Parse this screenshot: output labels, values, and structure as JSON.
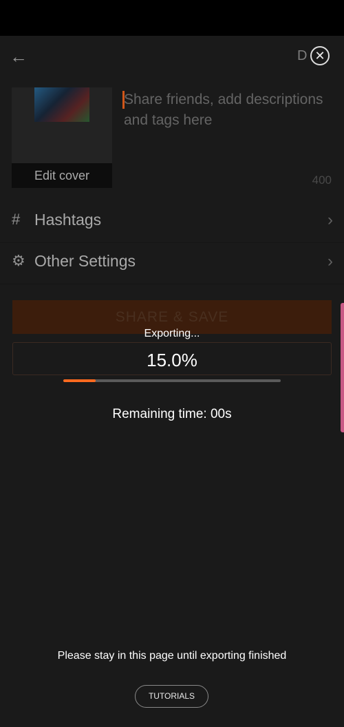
{
  "header": {
    "back_icon": "arrow-left-icon",
    "done_label": "D"
  },
  "cover": {
    "edit_label": "Edit cover"
  },
  "caption": {
    "placeholder": "Share friends, add descriptions and tags here",
    "char_limit": "400"
  },
  "rows": [
    {
      "icon": "hash-icon",
      "label": "Hashtags"
    },
    {
      "icon": "gear-icon",
      "label": "Other Settings"
    }
  ],
  "share_button": "SHARE & SAVE",
  "export": {
    "title": "Exporting...",
    "percent_text": "15.0%",
    "progress_fraction": 0.15,
    "remaining_text": "Remaining time: 00s",
    "stay_message": "Please stay in this page until exporting finished",
    "tutorials_label": "TUTORIALS"
  },
  "colors": {
    "accent": "#ff6a1f",
    "background": "#202020",
    "side_accent": "#c85a86"
  }
}
